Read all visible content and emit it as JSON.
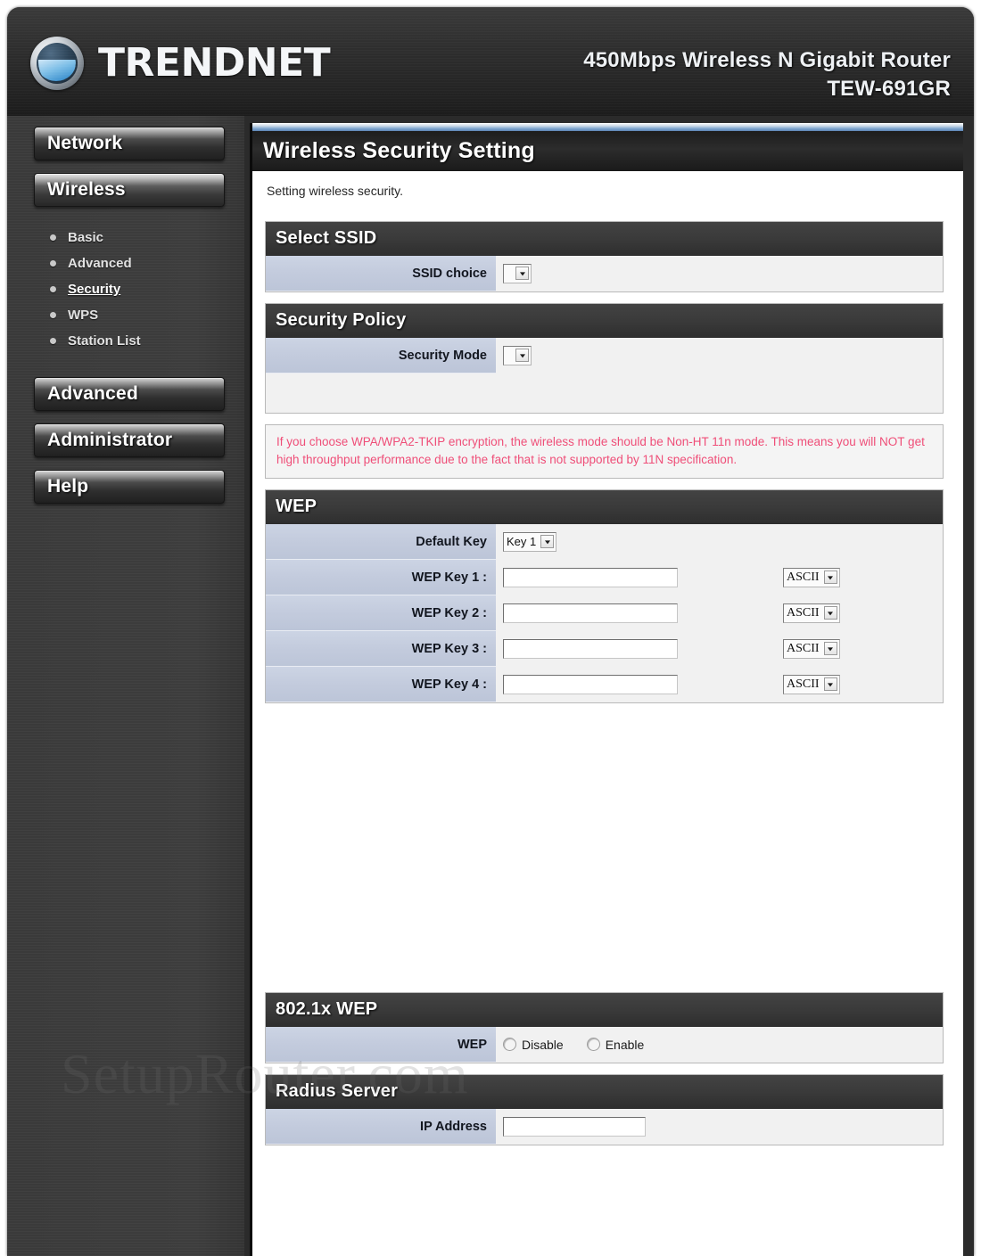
{
  "header": {
    "brand": "TRENDNET",
    "product_line": "450Mbps Wireless N Gigabit Router",
    "model": "TEW-691GR"
  },
  "sidebar": {
    "items": [
      {
        "label": "Network",
        "active": false
      },
      {
        "label": "Wireless",
        "active": true
      },
      {
        "label": "Advanced",
        "active": false
      },
      {
        "label": "Administrator",
        "active": false
      },
      {
        "label": "Help",
        "active": false
      }
    ],
    "wireless_submenu": [
      {
        "label": "Basic",
        "current": false
      },
      {
        "label": "Advanced",
        "current": false
      },
      {
        "label": "Security",
        "current": true
      },
      {
        "label": "WPS",
        "current": false
      },
      {
        "label": "Station List",
        "current": false
      }
    ]
  },
  "page": {
    "title": "Wireless Security Setting",
    "subtitle": "Setting wireless security."
  },
  "select_ssid": {
    "heading": "Select SSID",
    "ssid_choice_label": "SSID choice",
    "ssid_choice_value": ""
  },
  "security_policy": {
    "heading": "Security Policy",
    "security_mode_label": "Security Mode",
    "security_mode_value": ""
  },
  "warning": {
    "text": "If you choose WPA/WPA2-TKIP encryption, the wireless mode should be Non-HT 11n mode. This means you will NOT get high throughput performance due to the fact that is not supported by 11N specification."
  },
  "wep": {
    "heading": "WEP",
    "default_key_label": "Default Key",
    "default_key_value": "Key 1",
    "keys": [
      {
        "label": "WEP Key 1 :",
        "value": "",
        "encoding": "ASCII"
      },
      {
        "label": "WEP Key 2 :",
        "value": "",
        "encoding": "ASCII"
      },
      {
        "label": "WEP Key 3 :",
        "value": "",
        "encoding": "ASCII"
      },
      {
        "label": "WEP Key 4 :",
        "value": "",
        "encoding": "ASCII"
      }
    ]
  },
  "wep_8021x": {
    "heading": "802.1x WEP",
    "wep_label": "WEP",
    "options": [
      {
        "label": "Disable",
        "selected": false
      },
      {
        "label": "Enable",
        "selected": false
      }
    ]
  },
  "radius_server": {
    "heading": "Radius Server",
    "ip_address_label": "IP Address",
    "ip_address_value": ""
  },
  "watermark": {
    "text": "SetupRouter.com"
  },
  "colors": {
    "chrome": "#2b2b2b",
    "section_header": "#3a3a3a",
    "label_column": "#c3cbdd",
    "accent_blue": "#5d85b5",
    "warning_text": "#ef4e78"
  }
}
